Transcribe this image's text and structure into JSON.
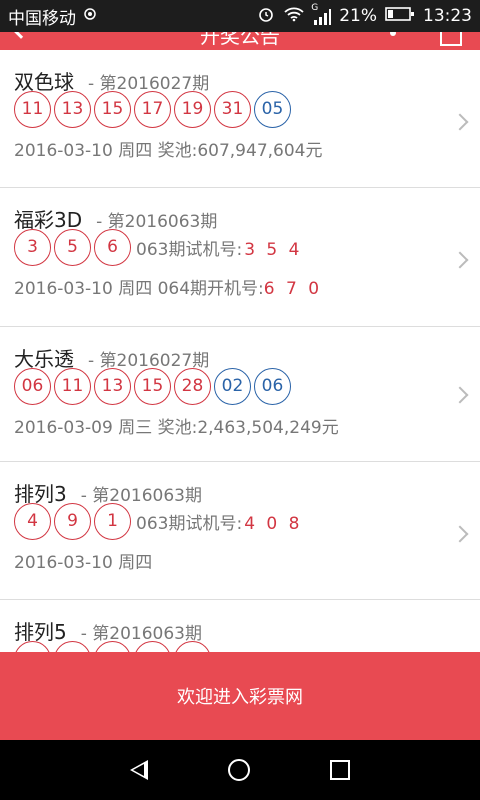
{
  "status_bar": {
    "carrier": "中国移动",
    "signal_type": "G",
    "battery": "21%",
    "time": "13:23"
  },
  "header": {
    "title": "开奖公告"
  },
  "lotteries": [
    {
      "name": "双色球",
      "issue": "- 第2016027期",
      "red_balls": [
        "11",
        "13",
        "15",
        "17",
        "19",
        "31"
      ],
      "blue_balls": [
        "05"
      ],
      "info": "2016-03-10  周四  奖池:607,947,604元"
    },
    {
      "name": "福彩3D",
      "issue": "- 第2016063期",
      "red_balls": [
        "3",
        "5",
        "6"
      ],
      "trial_label": "063期试机号:",
      "trial_numbers": "3 5 4",
      "info": "2016-03-10  周四  064期开机号:",
      "info_red": "6 7 0"
    },
    {
      "name": "大乐透",
      "issue": "- 第2016027期",
      "red_balls": [
        "06",
        "11",
        "13",
        "15",
        "28"
      ],
      "blue_balls": [
        "02",
        "06"
      ],
      "info": "2016-03-09  周三  奖池:2,463,504,249元"
    },
    {
      "name": "排列3",
      "issue": "- 第2016063期",
      "red_balls": [
        "4",
        "9",
        "1"
      ],
      "trial_label": "063期试机号:",
      "trial_numbers": "4 0 8",
      "info": "2016-03-10  周四"
    },
    {
      "name": "排列5",
      "issue": "- 第2016063期"
    }
  ],
  "footer": {
    "enter_label": "欢迎进入彩票网"
  },
  "colors": {
    "accent": "#e84a52",
    "red_ball": "#d23642",
    "blue_ball": "#2a63a8"
  }
}
